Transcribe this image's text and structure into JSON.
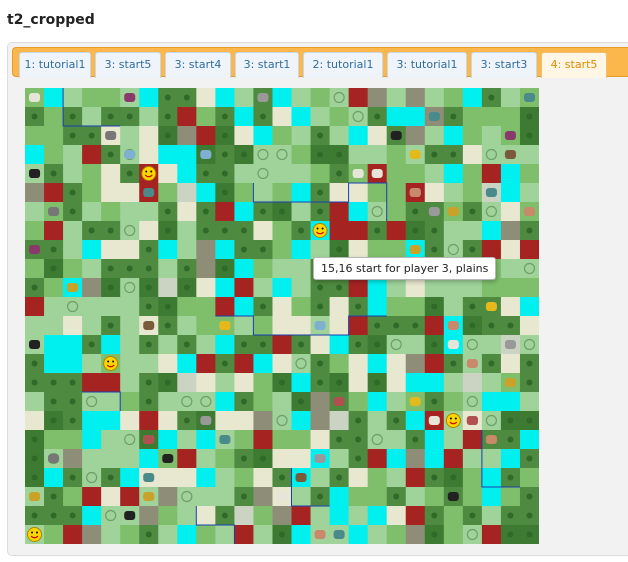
{
  "page": {
    "title": "t2_cropped"
  },
  "tabs": [
    {
      "label": "1: tutorial1",
      "active": false
    },
    {
      "label": "3: start5",
      "active": false
    },
    {
      "label": "3: start4",
      "active": false
    },
    {
      "label": "3: start1",
      "active": false
    },
    {
      "label": "2: tutorial1",
      "active": false
    },
    {
      "label": "3: tutorial1",
      "active": false
    },
    {
      "label": "3: start3",
      "active": false
    },
    {
      "label": "4: start5",
      "active": true
    }
  ],
  "map": {
    "cols": 27,
    "rows": 24,
    "tooltip": "15,16 start for player 3, plains",
    "colors": {
      "plains": "#9fd39a",
      "grassland": "#7fbf6b",
      "forest": "#4e8a3f",
      "jungle": "#3d7a32",
      "ocean": "#00f0f0",
      "desert": "#e8e8d0",
      "hills": "#8e8e78",
      "mountains": "#a8a8a8",
      "volcano": "#a52422",
      "tundra": "#cbd4c2"
    },
    "resource_icons": [
      "wheat-icon",
      "pig-icon",
      "elephant-icon",
      "horse-icon",
      "gold-icon",
      "whale-icon",
      "oasis-icon",
      "spice-icon",
      "wine-icon",
      "oil-icon",
      "iron-icon",
      "rice-icon"
    ],
    "start_icon": "smiley-icon"
  }
}
